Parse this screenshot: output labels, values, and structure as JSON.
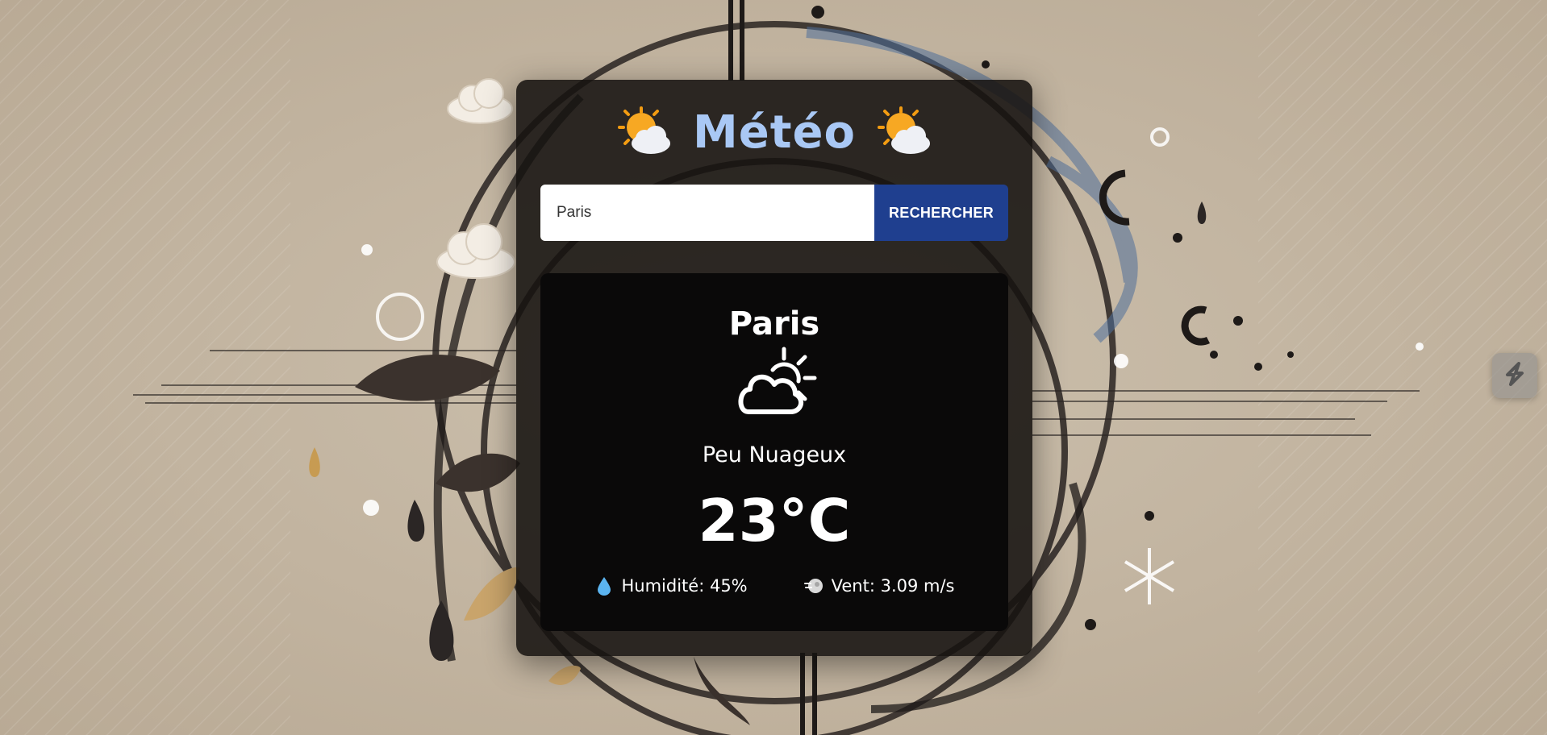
{
  "header": {
    "title": "Météo",
    "left_icon": "sun-behind-cloud-icon",
    "right_icon": "sun-behind-cloud-icon"
  },
  "search": {
    "value": "Paris",
    "placeholder": "",
    "button_label": "RECHERCHER"
  },
  "weather": {
    "city": "Paris",
    "icon": "partly-cloudy-icon",
    "condition": "Peu Nuageux",
    "temperature": "23°C",
    "humidity_label": "Humidité: 45%",
    "humidity_icon": "droplet-icon",
    "wind_label": "Vent: 3.09 m/s",
    "wind_icon": "wind-icon"
  },
  "side_widget": {
    "icon": "extension-icon"
  },
  "colors": {
    "title": "#a9c8f5",
    "button": "#1f3f8f",
    "card_bg": "#161210",
    "panel_bg": "#0a0909"
  }
}
